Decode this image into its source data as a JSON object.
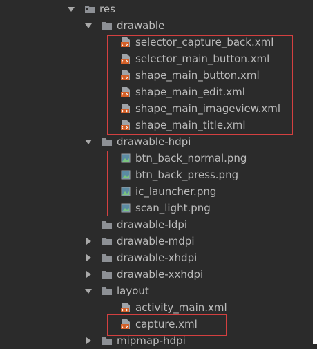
{
  "tree": {
    "res": {
      "label": "res",
      "expanded": true,
      "icon": "package-folder-icon"
    },
    "drawable": {
      "label": "drawable",
      "expanded": true,
      "files": [
        {
          "label": "selector_capture_back.xml",
          "icon": "xml-file-icon"
        },
        {
          "label": "selector_main_button.xml",
          "icon": "xml-file-icon"
        },
        {
          "label": "shape_main_button.xml",
          "icon": "xml-file-icon"
        },
        {
          "label": "shape_main_edit.xml",
          "icon": "xml-file-icon"
        },
        {
          "label": "shape_main_imageview.xml",
          "icon": "xml-file-icon"
        },
        {
          "label": "shape_main_title.xml",
          "icon": "xml-file-icon"
        }
      ]
    },
    "drawable_hdpi": {
      "label": "drawable-hdpi",
      "expanded": true,
      "files": [
        {
          "label": "btn_back_normal.png",
          "icon": "image-file-icon"
        },
        {
          "label": "btn_back_press.png",
          "icon": "image-file-icon"
        },
        {
          "label": "ic_launcher.png",
          "icon": "image-file-icon"
        },
        {
          "label": "scan_light.png",
          "icon": "image-file-icon"
        }
      ]
    },
    "drawable_ldpi": {
      "label": "drawable-ldpi",
      "expanded": false,
      "has_children": false
    },
    "drawable_mdpi": {
      "label": "drawable-mdpi",
      "expanded": false
    },
    "drawable_xhdpi": {
      "label": "drawable-xhdpi",
      "expanded": false
    },
    "drawable_xxhdpi": {
      "label": "drawable-xxhdpi",
      "expanded": false
    },
    "layout": {
      "label": "layout",
      "expanded": true,
      "files": [
        {
          "label": "activity_main.xml",
          "icon": "xml-file-icon"
        },
        {
          "label": "capture.xml",
          "icon": "xml-file-icon"
        }
      ]
    },
    "mipmap_hdpi": {
      "label": "mipmap-hdpi",
      "expanded": false
    }
  },
  "colors": {
    "background": "#2b2b2b",
    "text": "#bbbbbb",
    "folder": "#8d9095",
    "xml_badge": "#d35f27",
    "highlight_border": "#d34040"
  }
}
